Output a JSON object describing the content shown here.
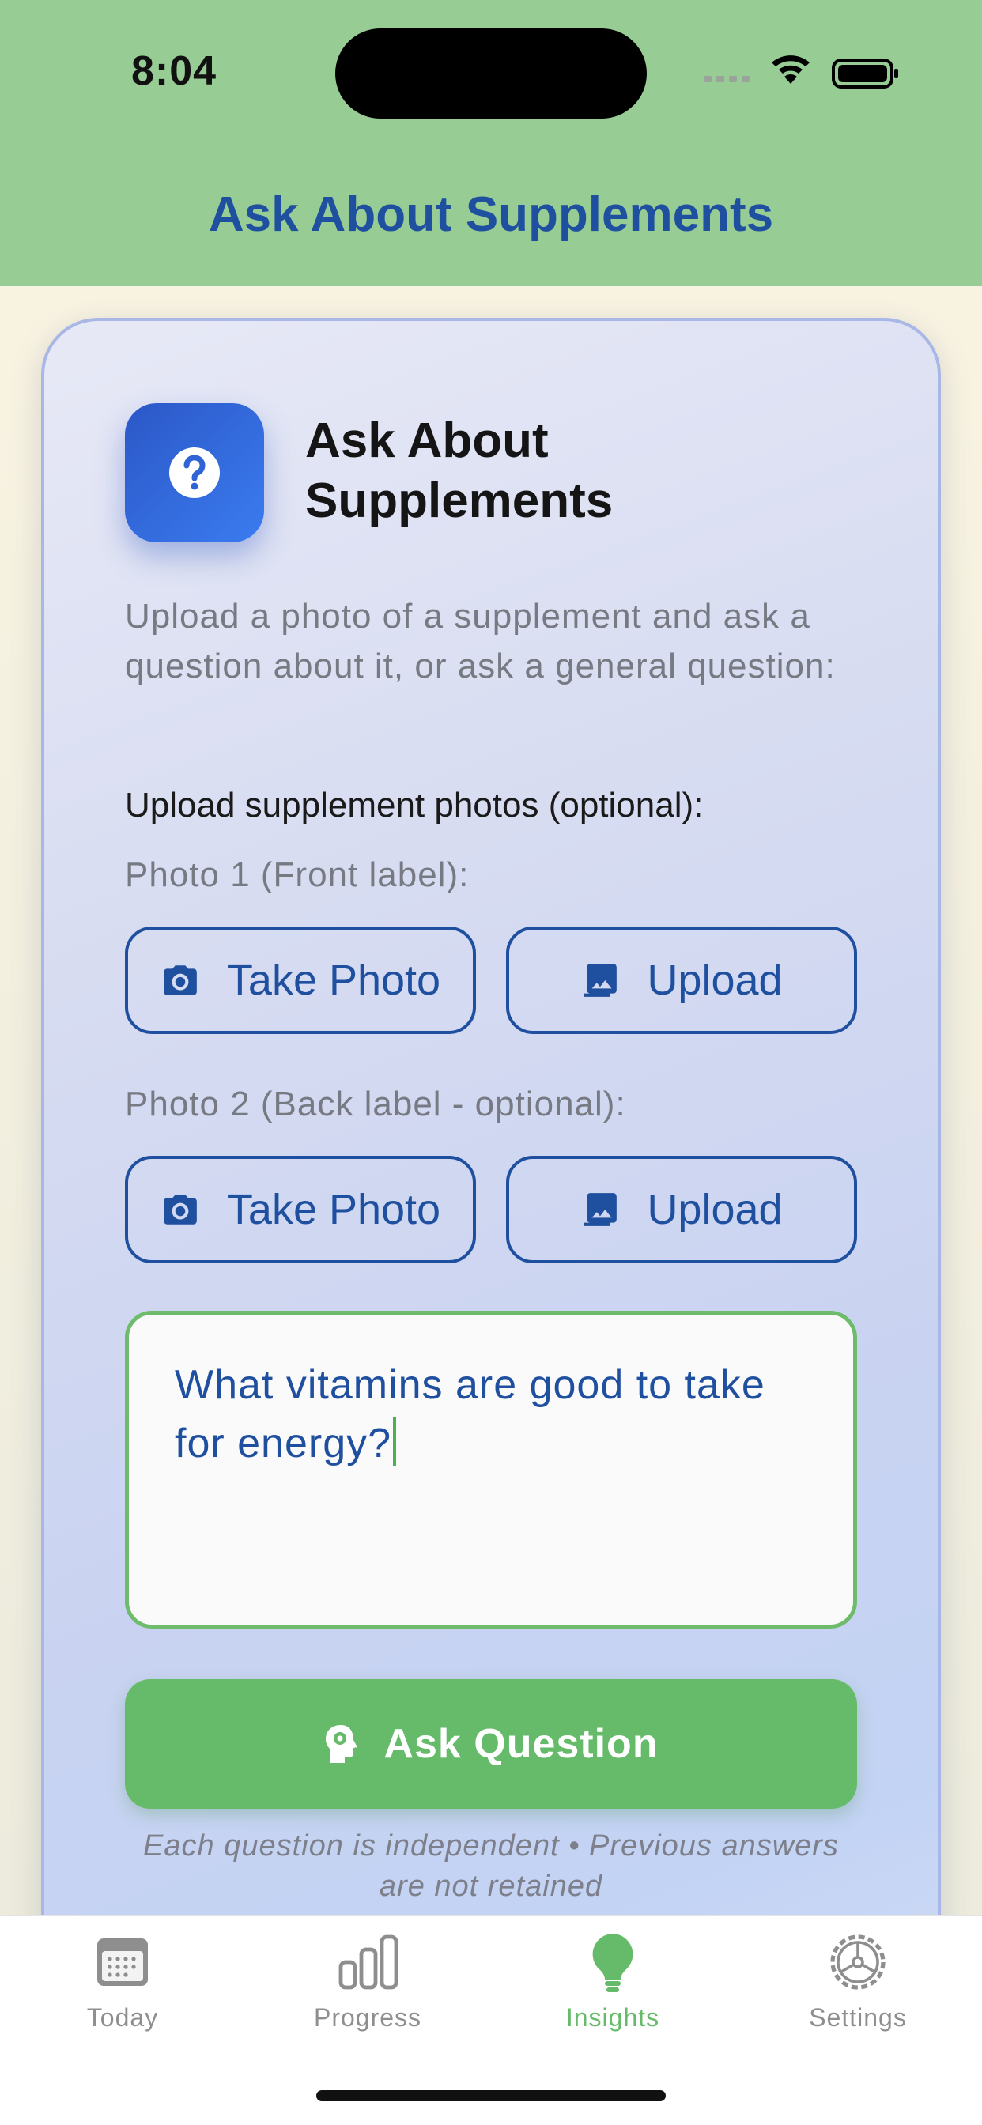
{
  "status_bar": {
    "time": "8:04"
  },
  "header": {
    "title": "Ask About Supplements"
  },
  "card": {
    "title": "Ask About Supplements",
    "intro": "Upload a photo of a supplement and ask a question about it, or ask a general question:",
    "upload_section_label": "Upload supplement photos (optional):",
    "photos": [
      {
        "label": "Photo 1 (Front label):",
        "take_photo": "Take Photo",
        "upload": "Upload"
      },
      {
        "label": "Photo 2 (Back label - optional):",
        "take_photo": "Take Photo",
        "upload": "Upload"
      }
    ],
    "question_value": "What vitamins are good to take for energy?",
    "ask_button": "Ask Question",
    "disclaimer": "Each question is independent • Previous answers are not retained"
  },
  "tabs": [
    {
      "label": "Today",
      "icon": "calendar-icon",
      "active": false
    },
    {
      "label": "Progress",
      "icon": "bar-chart-icon",
      "active": false
    },
    {
      "label": "Insights",
      "icon": "lightbulb-icon",
      "active": true
    },
    {
      "label": "Settings",
      "icon": "gear-icon",
      "active": false
    }
  ],
  "colors": {
    "header_bg": "#97cc94",
    "accent_blue": "#1f4f9f",
    "accent_green": "#66bb6a"
  }
}
